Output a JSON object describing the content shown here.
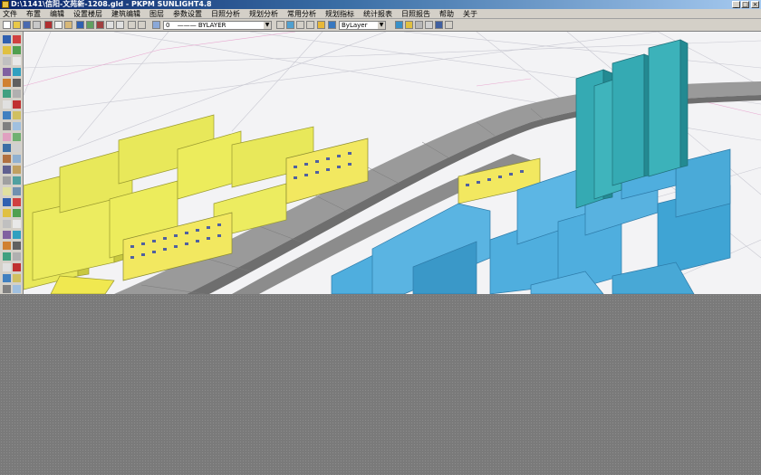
{
  "window": {
    "title": "D:\\1141\\信阳-文苑新-1208.gld - PKPM SUNLIGHT4.8",
    "buttons": [
      "_",
      "□",
      "×"
    ]
  },
  "menu": {
    "items": [
      "文件",
      "布置",
      "编辑",
      "设置楼层",
      "建筑编辑",
      "图层",
      "参数设置",
      "日照分析",
      "规划分析",
      "常用分析",
      "规划指标",
      "统计报表",
      "日照报告",
      "帮助",
      "关于"
    ]
  },
  "toolbar": {
    "layer_combo": "0",
    "line_combo": "——— BYLAYER",
    "color_combo": "ByLayer"
  },
  "colors": {
    "residential_yellow": "#e8e85a",
    "mid_blue": "#4faede",
    "tower_teal": "#35aab3",
    "viaduct_grey": "#8a8a8a"
  },
  "icons": [
    "new-icon",
    "open-icon",
    "save-icon",
    "print-icon",
    "undo-icon",
    "redo-icon",
    "zoom-icon",
    "pan-icon",
    "rotate-icon",
    "properties-icon",
    "line-icon",
    "circle-icon",
    "polyline-icon",
    "move-icon",
    "copy-icon",
    "erase-icon"
  ]
}
